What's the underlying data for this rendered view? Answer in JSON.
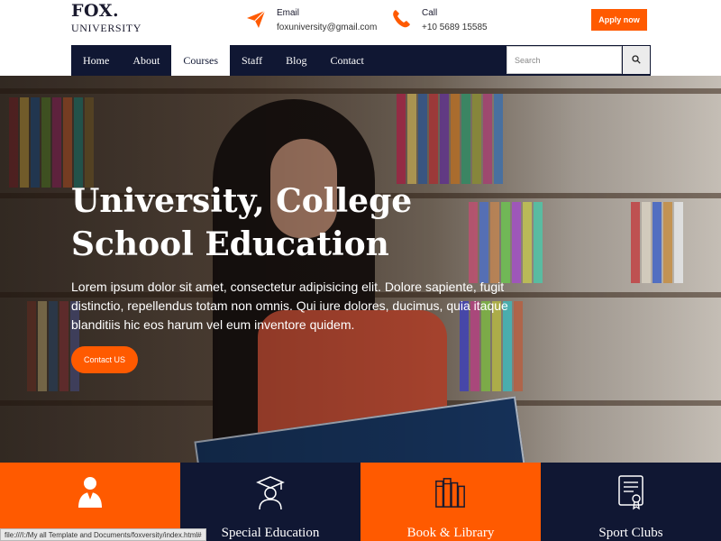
{
  "brand": {
    "name": "FOX.",
    "subtitle": "UNIVERSITY"
  },
  "contacts": [
    {
      "label": "Email",
      "value": "foxuniversity@gmail.com",
      "icon": "paper-plane-icon"
    },
    {
      "label": "Call",
      "value": "+10 5689 15585",
      "icon": "phone-icon"
    }
  ],
  "apply_label": "Apply now",
  "nav": {
    "items": [
      "Home",
      "About",
      "Courses",
      "Staff",
      "Blog",
      "Contact"
    ],
    "active": "Courses",
    "search_placeholder": "Search",
    "search_icon": "search-icon"
  },
  "hero": {
    "title": "University, College School Education",
    "text": "Lorem ipsum dolor sit amet, consectetur adipisicing elit. Dolore sapiente, fugit distinctio, repellendus totam non omnis. Qui iure dolores, ducimus, quia itaque blanditiis hic eos harum vel eum inventore quidem.",
    "button_label": "Contact US"
  },
  "features": [
    {
      "label": "",
      "icon": "graduate-person-icon",
      "color": "#ff5a00"
    },
    {
      "label": "Special Education",
      "icon": "graduation-cap-icon",
      "color": "#101733"
    },
    {
      "label": "Book & Library",
      "icon": "books-icon",
      "color": "#ff5a00"
    },
    {
      "label": "Sport Clubs",
      "icon": "certificate-icon",
      "color": "#101733"
    }
  ],
  "status_bar": "file:///I:/My all Template and Documents/foxversity/index.html#",
  "colors": {
    "accent": "#ff5a00",
    "navy": "#101733"
  }
}
